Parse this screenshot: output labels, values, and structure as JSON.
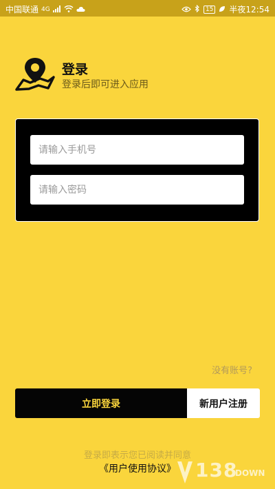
{
  "status_bar": {
    "carrier": "中国联通",
    "network": "4G",
    "battery": "15",
    "time": "半夜12:54"
  },
  "header": {
    "title": "登录",
    "subtitle": "登录后即可进入应用",
    "logo_icon": "location-map-icon"
  },
  "form": {
    "phone_placeholder": "请输入手机号",
    "phone_value": "",
    "password_placeholder": "请输入密码",
    "password_value": ""
  },
  "no_account_label": "没有账号?",
  "actions": {
    "login_label": "立即登录",
    "register_label": "新用户注册"
  },
  "agreement": {
    "notice": "登录即表示您已阅读并同意",
    "link": "《用户使用协议》"
  },
  "watermark": {
    "number": "138",
    "text": "DOWN"
  },
  "colors": {
    "background": "#fad53c",
    "accent": "#050505",
    "button_text": "#fad53c"
  }
}
